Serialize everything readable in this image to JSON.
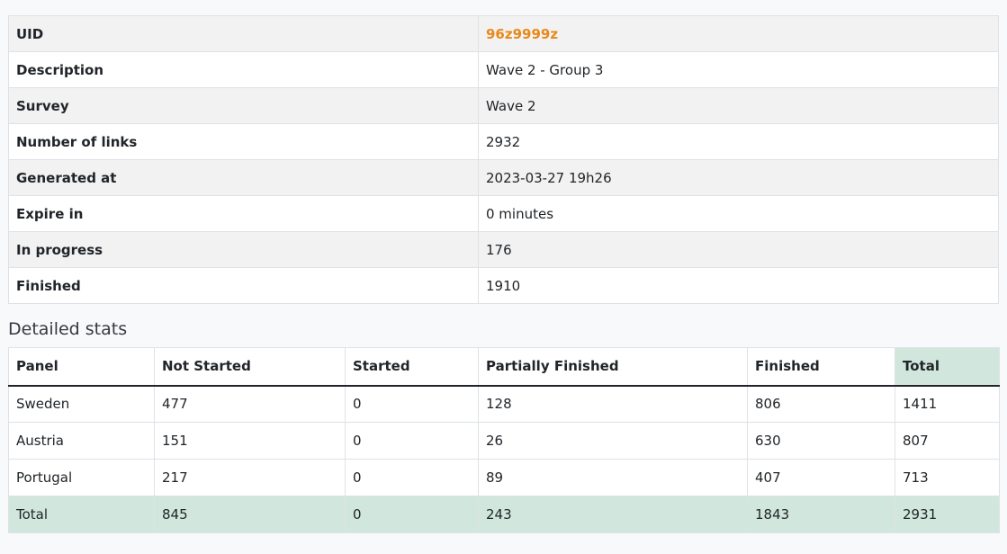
{
  "info": {
    "rows": [
      {
        "label": "UID",
        "value": "96z9999z"
      },
      {
        "label": "Description",
        "value": "Wave 2 - Group 3"
      },
      {
        "label": "Survey",
        "value": "Wave 2"
      },
      {
        "label": "Number of links",
        "value": "2932"
      },
      {
        "label": "Generated at",
        "value": "2023-03-27 19h26"
      },
      {
        "label": "Expire in",
        "value": "0 minutes"
      },
      {
        "label": "In progress",
        "value": "176"
      },
      {
        "label": "Finished",
        "value": "1910"
      }
    ],
    "uid_color": "#e8891a"
  },
  "stats": {
    "heading": "Detailed stats",
    "columns": [
      "Panel",
      "Not Started",
      "Started",
      "Partially Finished",
      "Finished",
      "Total"
    ],
    "rows": [
      [
        "Sweden",
        "477",
        "0",
        "128",
        "806",
        "1411"
      ],
      [
        "Austria",
        "151",
        "0",
        "26",
        "630",
        "807"
      ],
      [
        "Portugal",
        "217",
        "0",
        "89",
        "407",
        "713"
      ]
    ],
    "total_row": [
      "Total",
      "845",
      "0",
      "243",
      "1843",
      "2931"
    ],
    "highlight_color": "#d1e7dd"
  }
}
